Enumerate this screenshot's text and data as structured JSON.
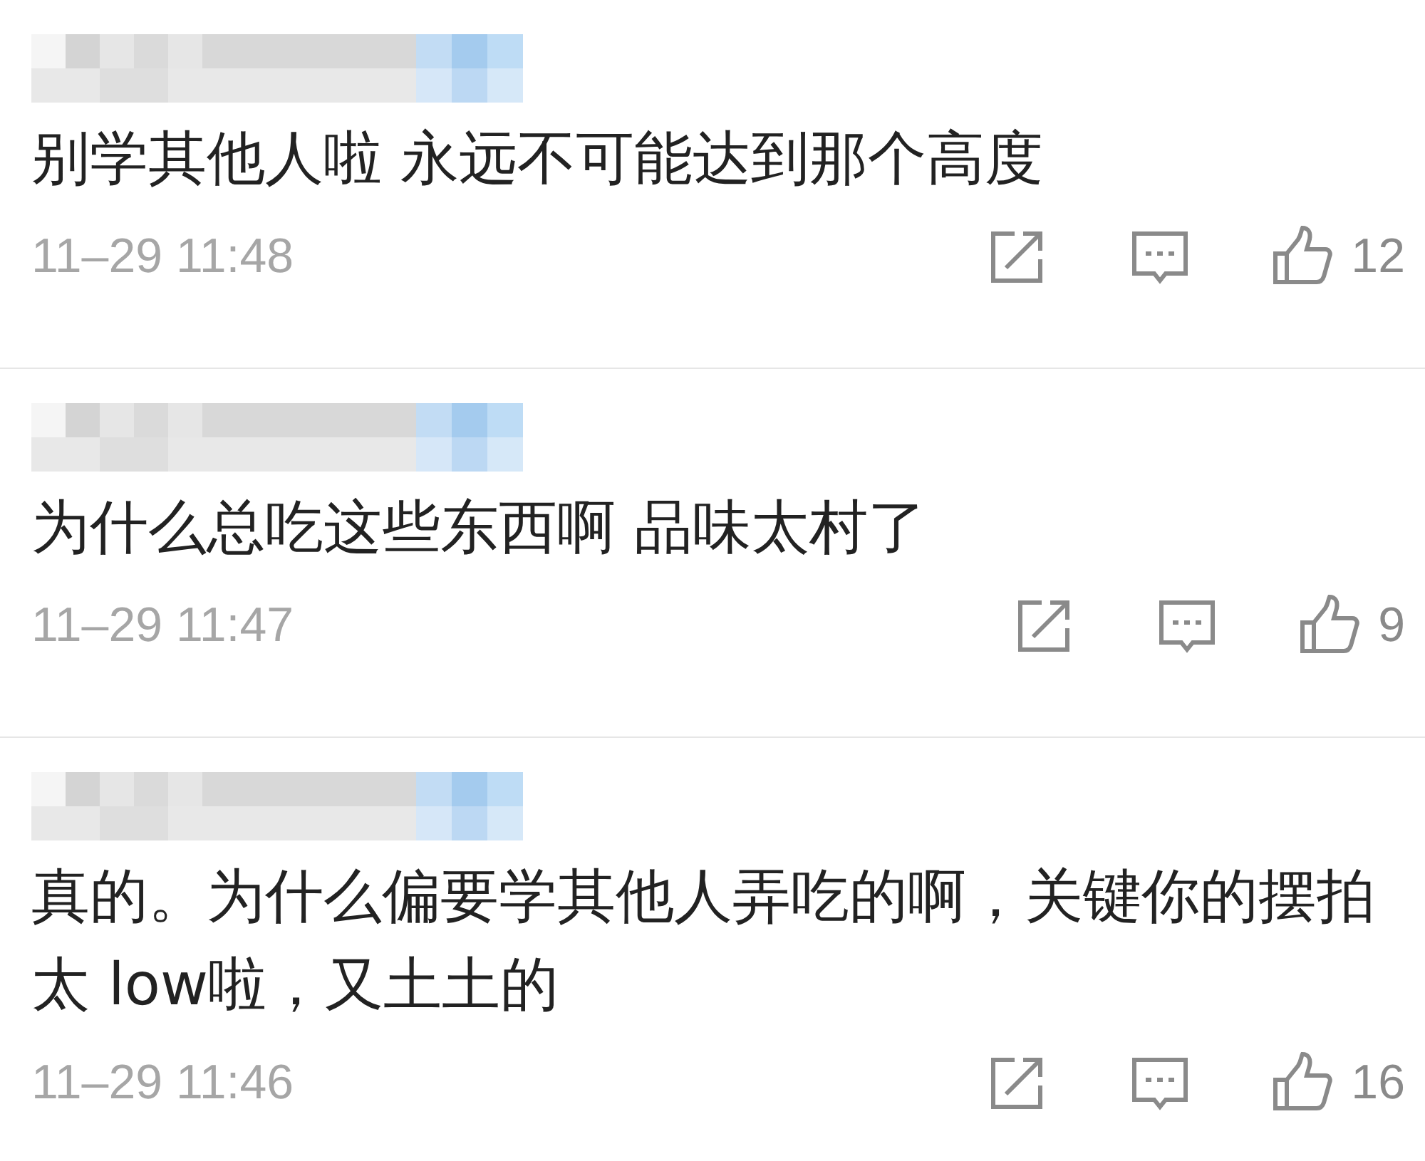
{
  "comments": [
    {
      "text": "别学其他人啦 永远不可能达到那个高度",
      "time": "11–29 11:48",
      "likes": "12"
    },
    {
      "text": "为什么总吃这些东西啊 品味太村了",
      "time": "11–29 11:47",
      "likes": "9"
    },
    {
      "text": "真的。为什么偏要学其他人弄吃的啊，关键你的摆拍太 low啦，又土土的",
      "time": "11–29 11:46",
      "likes": "16"
    }
  ]
}
